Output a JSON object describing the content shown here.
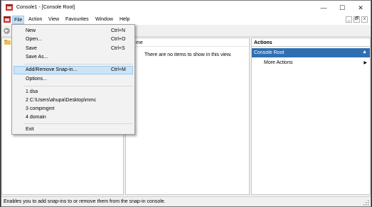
{
  "window": {
    "title": "Console1 - [Console Root]",
    "controls": {
      "minimize": "—",
      "maximize": "☐",
      "close": "✕"
    }
  },
  "menubar": {
    "items": [
      "File",
      "Action",
      "View",
      "Favourites",
      "Window",
      "Help"
    ],
    "mdi_controls": {
      "minimize": "_",
      "restore": "🗗",
      "close": "x"
    }
  },
  "file_menu": {
    "groups": [
      [
        {
          "label": "New",
          "shortcut": "Ctrl+N"
        },
        {
          "label": "Open...",
          "shortcut": "Ctrl+O"
        },
        {
          "label": "Save",
          "shortcut": "Ctrl+S"
        },
        {
          "label": "Save As...",
          "shortcut": ""
        }
      ],
      [
        {
          "label": "Add/Remove Snap-in...",
          "shortcut": "Ctrl+M",
          "highlighted": true
        },
        {
          "label": "Options...",
          "shortcut": ""
        }
      ],
      [
        {
          "label": "1 dsa",
          "shortcut": ""
        },
        {
          "label": "2 C:\\Users\\ahupa\\Desktop\\mmc",
          "shortcut": ""
        },
        {
          "label": "3 compmgmt",
          "shortcut": ""
        },
        {
          "label": "4 domain",
          "shortcut": ""
        }
      ],
      [
        {
          "label": "Exit",
          "shortcut": ""
        }
      ]
    ]
  },
  "center_pane": {
    "column_header": "me",
    "empty_message": "There are no items to show in this view."
  },
  "actions_pane": {
    "header": "Actions",
    "group": "Console Root",
    "items": [
      "More Actions"
    ]
  },
  "statusbar": {
    "text": "Enables you to add snap-ins to or remove them from the snap-in console."
  },
  "colors": {
    "accent": "#2f6fb1",
    "highlight": "#cce4f7",
    "highlight_border": "#99c9ef",
    "app_icon_red": "#c9302c"
  },
  "icons": [
    "mmc-app-icon",
    "back-arrow-icon",
    "folder-icon",
    "caret-up-icon",
    "arrow-right-icon"
  ]
}
